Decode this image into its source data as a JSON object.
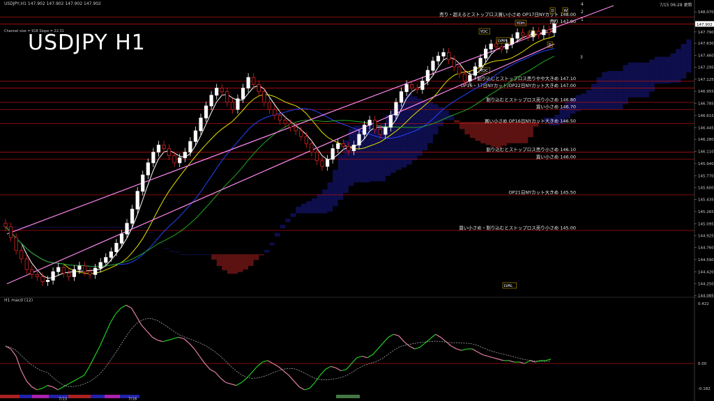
{
  "header": {
    "symbol_line": "USDJPY,H1  147.902 147.902 147.902 147.902",
    "channel_info": "Channel size = 918 Slope = 22.31",
    "timestamp": "7/15 06:28 更新"
  },
  "main_title": "USDJPY H1",
  "macd_label": "H1  macd (12)",
  "colors": {
    "background": "#000000",
    "bull_candle": "#ffffff",
    "bear_candle": "#dd2222",
    "ma_white": "#ffffff",
    "ma_yellow": "#e8e000",
    "ma_blue": "#2244ff",
    "channel": "#ff88ee",
    "level_line": "#b01010",
    "cloud_bull": "#1a1a8a",
    "cloud_bear": "#aa2020",
    "macd_green": "#22cc22",
    "macd_pink": "#e080a0",
    "green_line": "#22aa22",
    "olive_line": "#9a9a00"
  },
  "chart_data": {
    "type": "candlestick",
    "ylim": [
      144.08,
      148.16
    ],
    "y_ticks": [
      148.07,
      147.902,
      147.79,
      147.63,
      147.46,
      147.295,
      147.125,
      146.955,
      146.785,
      146.615,
      146.445,
      146.28,
      146.11,
      145.94,
      145.77,
      145.6,
      145.435,
      145.265,
      145.095,
      144.925,
      144.76,
      144.59,
      144.42,
      144.25,
      144.085
    ],
    "current_price": 147.902,
    "candle_closes": [
      145.05,
      144.9,
      144.72,
      144.6,
      144.45,
      144.38,
      144.35,
      144.28,
      144.3,
      144.42,
      144.48,
      144.4,
      144.35,
      144.45,
      144.5,
      144.42,
      144.38,
      144.47,
      144.55,
      144.62,
      144.7,
      144.82,
      144.95,
      145.1,
      145.3,
      145.55,
      145.78,
      145.95,
      146.1,
      146.2,
      146.15,
      146.05,
      145.95,
      146.02,
      146.1,
      146.25,
      146.4,
      146.58,
      146.75,
      146.9,
      147.0,
      146.95,
      146.8,
      146.7,
      146.85,
      147.0,
      147.15,
      147.05,
      146.95,
      146.8,
      146.7,
      146.62,
      146.55,
      146.5,
      146.45,
      146.4,
      146.32,
      146.22,
      146.1,
      145.98,
      145.9,
      146.0,
      146.15,
      146.22,
      146.18,
      146.12,
      146.2,
      146.35,
      146.48,
      146.55,
      146.42,
      146.35,
      146.45,
      146.62,
      146.8,
      146.95,
      147.05,
      147.0,
      146.98,
      147.1,
      147.25,
      147.38,
      147.45,
      147.5,
      147.4,
      147.3,
      147.2,
      147.1,
      147.18,
      147.3,
      147.42,
      147.55,
      147.62,
      147.58,
      147.55,
      147.62,
      147.7,
      147.78,
      147.74,
      147.72,
      147.8,
      147.75,
      147.82,
      147.78,
      147.902
    ],
    "levels": [
      {
        "price": 148.0,
        "label": "売り・超えるとストップロス買い小さめ  OP17日NYカット 148.00"
      },
      {
        "price": 147.9,
        "label": "売り 147.90"
      },
      {
        "price": 147.1,
        "label": "割り込むとストップロス売りやや大きめ 147.10"
      },
      {
        "price": 147.0,
        "label": "OP16・17日NYカット/OP22日NYカット大きめ 147.00"
      },
      {
        "price": 146.8,
        "label": "割り込むとストップロス売り小さめ 146.80"
      },
      {
        "price": 146.7,
        "label": "買い小さめ 146.70"
      },
      {
        "price": 146.5,
        "label": "買い小さめ  OP16日NYカット大きめ 146.50"
      },
      {
        "price": 146.1,
        "label": "割り込むとストップロス売り小さめ 146.10"
      },
      {
        "price": 146.0,
        "label": "買い小さめ 146.00"
      },
      {
        "price": 145.5,
        "label": "OP21日NYカット大きめ 145.50"
      },
      {
        "price": 145.0,
        "label": "買い小さめ・割り込むとストップロス売り小さめ 145.00"
      }
    ],
    "markers": [
      "YDC",
      "YDC",
      "YDH",
      "LVAH",
      "LVAL",
      "W",
      "D",
      "W",
      "D"
    ],
    "right_numbers": [
      "4",
      "2",
      "1",
      "3"
    ],
    "macd_ticks": [
      "0.422",
      "0.00",
      "-0.182"
    ],
    "x_labels": [
      "7/15",
      "7/16"
    ],
    "macd_values": [
      0.12,
      0.1,
      0.05,
      -0.05,
      -0.12,
      -0.16,
      -0.18,
      -0.17,
      -0.15,
      -0.16,
      -0.18,
      -0.16,
      -0.14,
      -0.12,
      -0.1,
      -0.08,
      -0.02,
      0.05,
      0.12,
      0.2,
      0.28,
      0.34,
      0.38,
      0.4,
      0.38,
      0.32,
      0.26,
      0.22,
      0.18,
      0.16,
      0.15,
      0.16,
      0.17,
      0.18,
      0.17,
      0.14,
      0.1,
      0.05,
      0.0,
      -0.04,
      -0.06,
      -0.1,
      -0.13,
      -0.14,
      -0.15,
      -0.13,
      -0.1,
      -0.06,
      -0.02,
      0.01,
      0.02,
      0.0,
      -0.02,
      -0.05,
      -0.08,
      -0.12,
      -0.16,
      -0.18,
      -0.17,
      -0.13,
      -0.08,
      -0.04,
      -0.02,
      -0.03,
      -0.05,
      -0.04,
      0.0,
      0.04,
      0.05,
      0.04,
      0.06,
      0.1,
      0.14,
      0.18,
      0.2,
      0.19,
      0.15,
      0.12,
      0.1,
      0.11,
      0.14,
      0.17,
      0.2,
      0.18,
      0.15,
      0.12,
      0.1,
      0.09,
      0.1,
      0.1,
      0.08,
      0.06,
      0.05,
      0.04,
      0.03,
      0.02,
      0.02,
      0.01,
      0.01,
      0.0,
      0.02,
      0.01,
      0.02,
      0.02,
      0.03
    ]
  }
}
